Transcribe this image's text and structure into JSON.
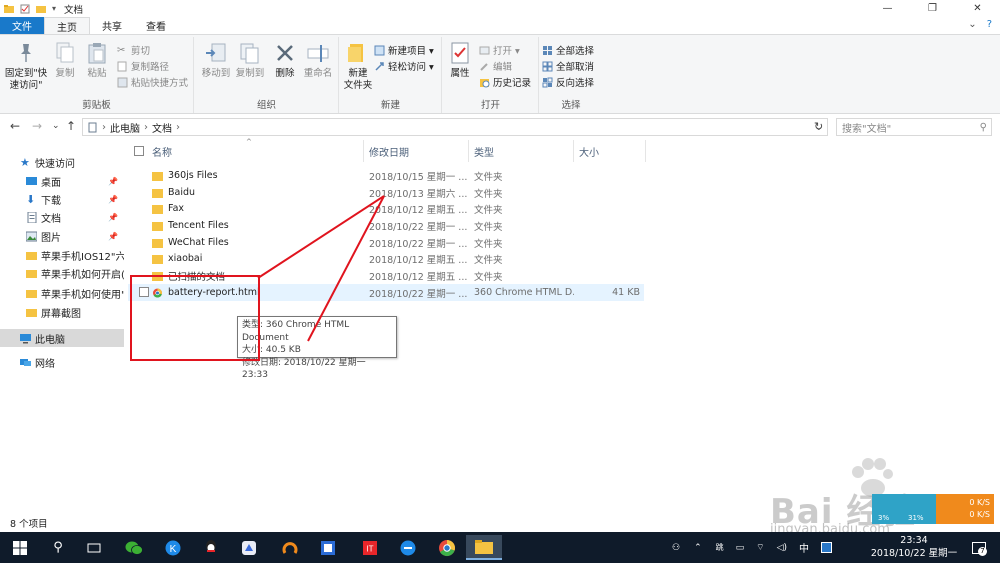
{
  "window": {
    "title": "文档"
  },
  "titlebar": {
    "minimize": "—",
    "maximize": "❐",
    "close": "✕"
  },
  "tabs": {
    "file": "文件",
    "home": "主页",
    "share": "共享",
    "view": "查看"
  },
  "ribbon": {
    "clipboard": {
      "label": "剪贴板",
      "pin": "固定到\"快\n速访问\"",
      "copy": "复制",
      "paste": "粘贴",
      "cut": "剪切",
      "copy_path": "复制路径",
      "paste_shortcut": "粘贴快捷方式"
    },
    "organize": {
      "label": "组织",
      "move_to": "移动到",
      "copy_to": "复制到",
      "delete": "删除",
      "rename": "重命名"
    },
    "new": {
      "label": "新建",
      "new_folder": "新建\n文件夹",
      "new_item": "新建项目 ▾",
      "easy_access": "轻松访问 ▾"
    },
    "open": {
      "label": "打开",
      "properties": "属性",
      "open": "打开 ▾",
      "edit": "编辑",
      "history": "历史记录"
    },
    "select": {
      "label": "选择",
      "select_all": "全部选择",
      "select_none": "全部取消",
      "invert": "反向选择"
    }
  },
  "address": {
    "parts": [
      "此电脑",
      "文档"
    ],
    "separator": "›",
    "search_placeholder": "搜索\"文档\""
  },
  "nav": {
    "quick_access": "快速访问",
    "items": [
      {
        "label": "桌面",
        "pinned": true
      },
      {
        "label": "下载",
        "pinned": true
      },
      {
        "label": "文档",
        "pinned": true
      },
      {
        "label": "图片",
        "pinned": true
      },
      {
        "label": "苹果手机IOS12\"六六",
        "pinned": false
      },
      {
        "label": "苹果手机如何开启(",
        "pinned": false
      },
      {
        "label": "苹果手机如何使用\"",
        "pinned": false
      },
      {
        "label": "屏幕截图",
        "pinned": false
      }
    ],
    "this_pc": "此电脑",
    "network": "网络"
  },
  "columns": {
    "name": "名称",
    "date": "修改日期",
    "type": "类型",
    "size": "大小"
  },
  "files": [
    {
      "name": "360js Files",
      "date": "2018/10/15 星期一 ...",
      "type": "文件夹",
      "size": ""
    },
    {
      "name": "Baidu",
      "date": "2018/10/13 星期六 ...",
      "type": "文件夹",
      "size": ""
    },
    {
      "name": "Fax",
      "date": "2018/10/12 星期五 ...",
      "type": "文件夹",
      "size": ""
    },
    {
      "name": "Tencent Files",
      "date": "2018/10/22 星期一 ...",
      "type": "文件夹",
      "size": ""
    },
    {
      "name": "WeChat Files",
      "date": "2018/10/22 星期一 ...",
      "type": "文件夹",
      "size": ""
    },
    {
      "name": "xiaobai",
      "date": "2018/10/12 星期五 ...",
      "type": "文件夹",
      "size": ""
    },
    {
      "name": "已扫描的文档",
      "date": "2018/10/12 星期五 ...",
      "type": "文件夹",
      "size": ""
    },
    {
      "name": "battery-report.html",
      "date": "2018/10/22 星期一 ...",
      "type": "360 Chrome HTML D...",
      "size": "41 KB"
    }
  ],
  "tooltip": {
    "type": "类型: 360 Chrome HTML Document",
    "size": "大小: 40.5 KB",
    "modified": "修改日期: 2018/10/22 星期一 23:33"
  },
  "status": {
    "count": "8 个项目"
  },
  "network_widget": {
    "up": "0 K/S",
    "down": "0 K/S",
    "pct1": "3%",
    "pct2": "31%"
  },
  "watermark": {
    "line1": "Bai 经验",
    "line2": "jingyan.baidu.com"
  },
  "taskbar": {
    "ime": "中",
    "time": "23:34",
    "date": "2018/10/22 星期一",
    "notifications": "7"
  },
  "colors": {
    "accent": "#1979ca",
    "annotation": "#e0141e",
    "taskbar": "#0f1b2a",
    "folder": "#f5c342"
  }
}
